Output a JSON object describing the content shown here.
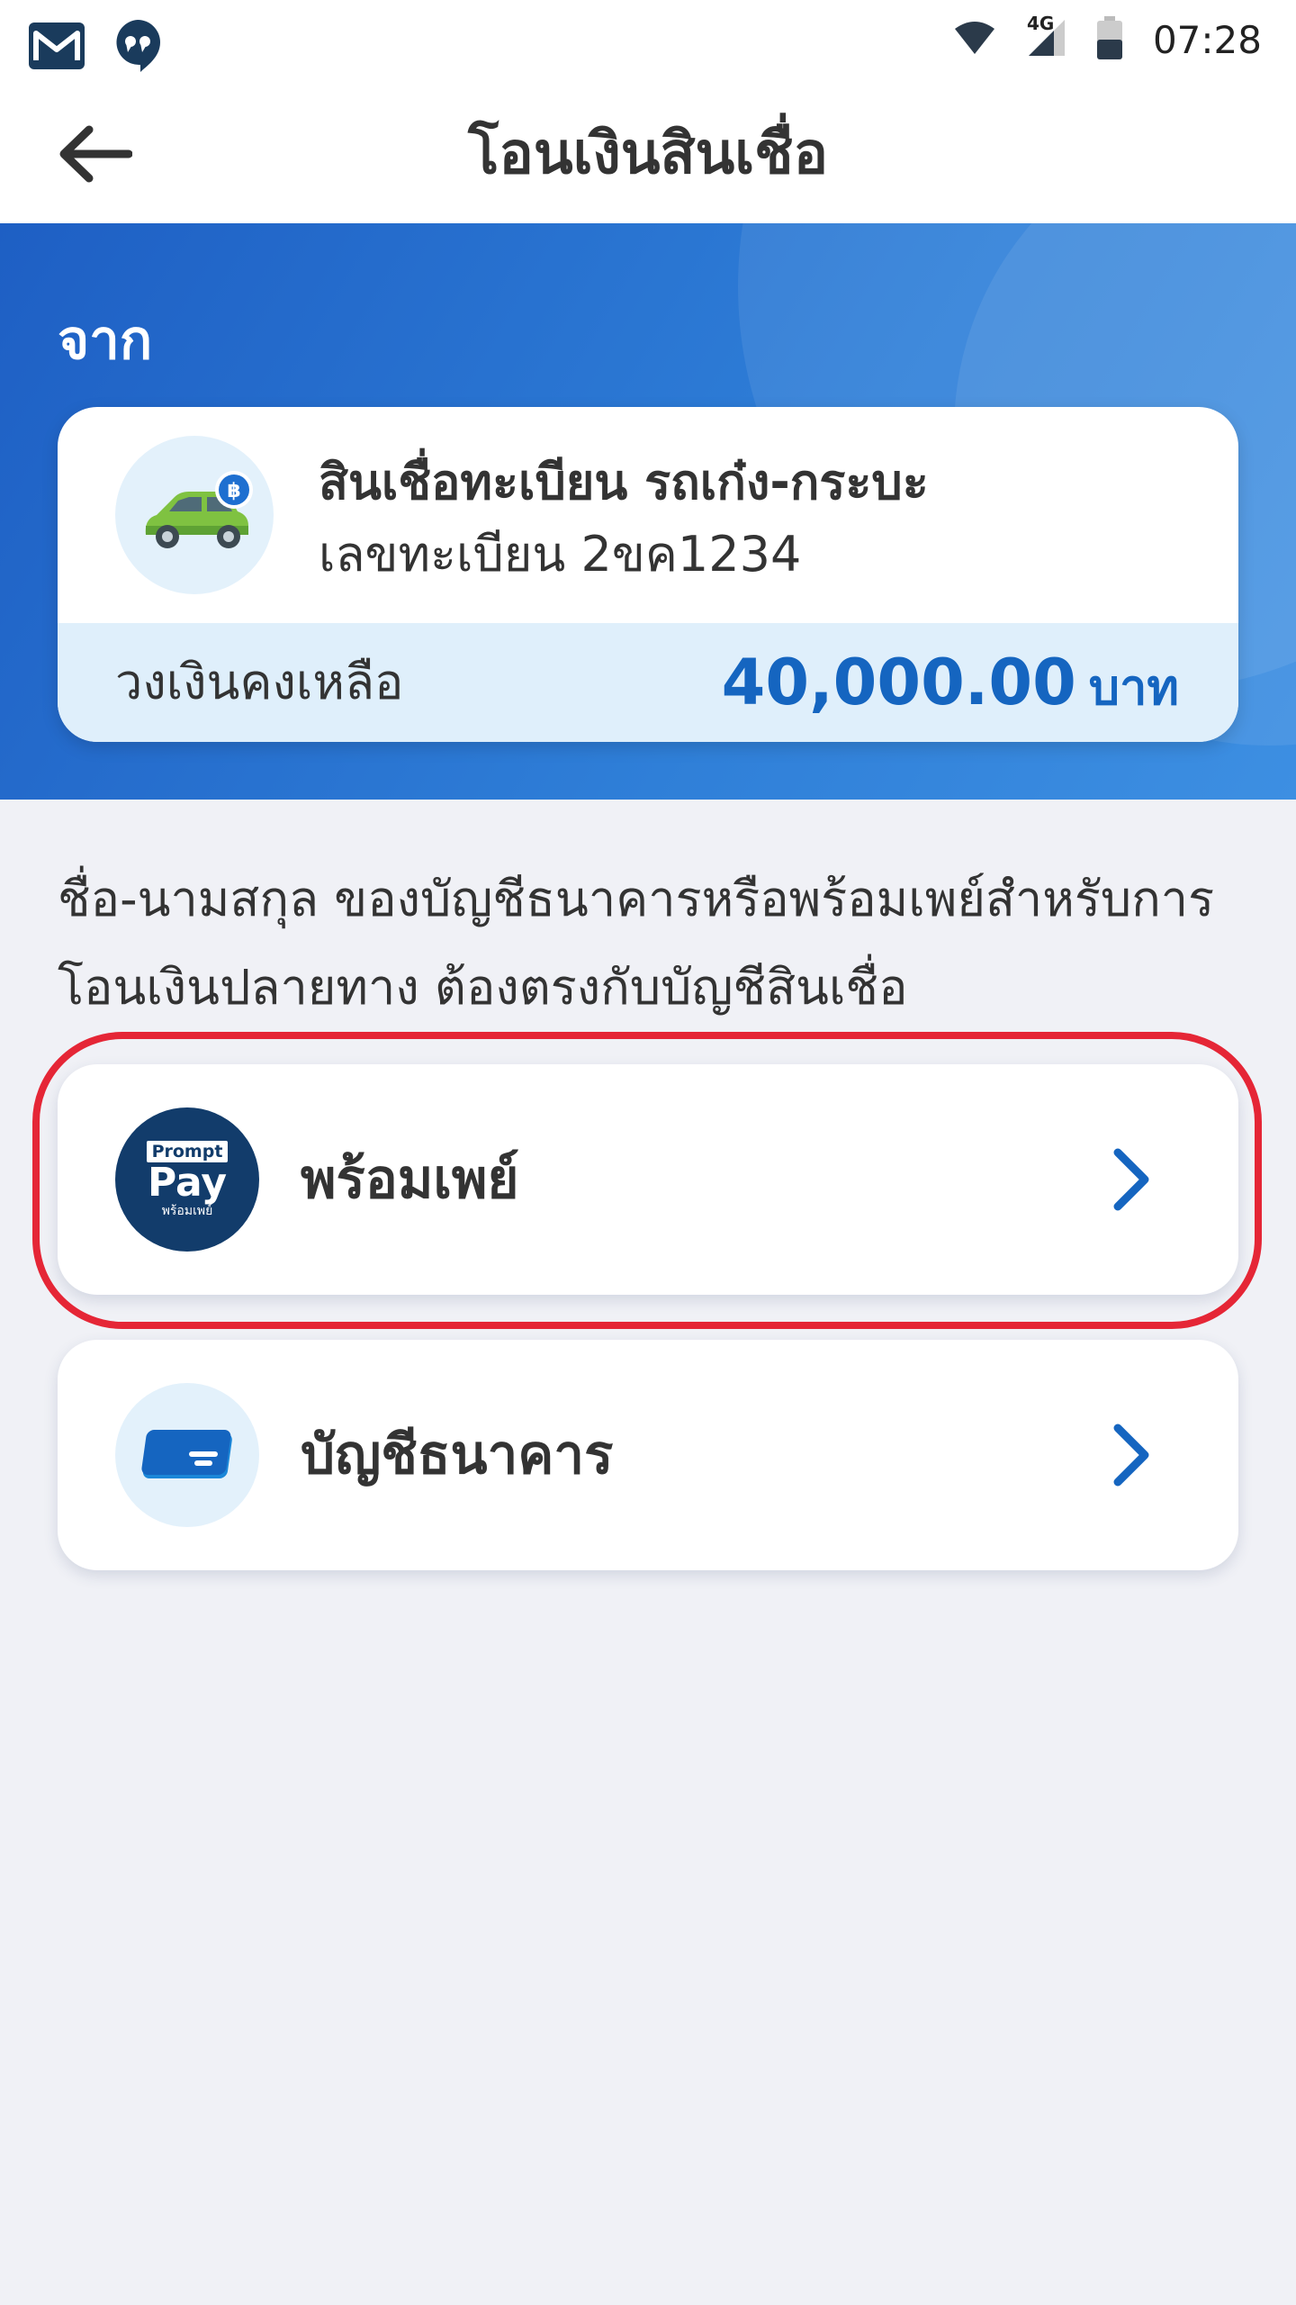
{
  "status_bar": {
    "time": "07:28",
    "network": "4G",
    "icons": [
      "gmail-icon",
      "hangouts-icon",
      "wifi-icon",
      "signal-icon",
      "battery-icon"
    ]
  },
  "app_bar": {
    "title": "โอนเงินสินเชื่อ",
    "back_icon": "back-arrow-icon"
  },
  "from_section": {
    "label": "จาก",
    "loan": {
      "name": "สินเชื่อทะเบียน รถเก๋ง-กระบะ",
      "plate": "เลขทะเบียน 2ขค1234",
      "icon": "car-baht-icon",
      "balance_label": "วงเงินคงเหลือ",
      "balance_amount": "40,000.00",
      "balance_unit": "บาท"
    }
  },
  "note": "ชื่อ-นามสกุล ของบัญชีธนาคารหรือพร้อมเพย์สำหรับการโอนเงินปลายทาง ต้องตรงกับบัญชีสินเชื่อ",
  "options": [
    {
      "label": "พร้อมเพย์",
      "icon": "promptpay-icon",
      "logo_top": "Prompt",
      "logo_main": "Pay",
      "logo_sub": "พร้อมเพย์"
    },
    {
      "label": "บัญชีธนาคาร",
      "icon": "bank-card-icon"
    }
  ],
  "colors": {
    "primary_blue": "#1565c0",
    "header_gradient_start": "#1e5fc4",
    "header_gradient_end": "#3d8fe2",
    "highlight_red": "#e52636",
    "promptpay_navy": "#123c6b",
    "background": "#f0f1f6"
  }
}
